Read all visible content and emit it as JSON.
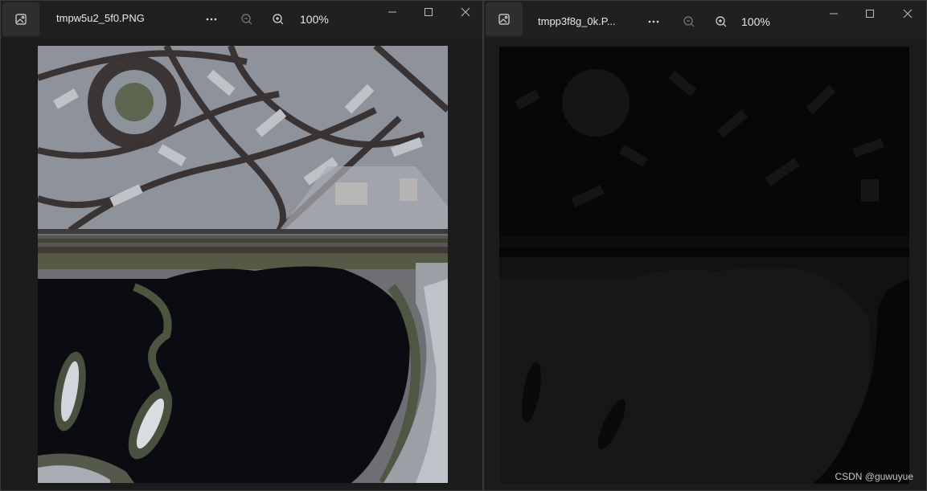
{
  "windows": [
    {
      "title": "tmpw5u2_5f0.PNG",
      "zoom": "100%"
    },
    {
      "title": "tmpp3f8g_0k.P...",
      "zoom": "100%"
    }
  ],
  "watermark": "CSDN @guwuyue",
  "icons": {
    "app": "image-icon",
    "more": "more-icon",
    "zoom_out": "zoom-out-icon",
    "zoom_in": "zoom-in-icon",
    "minimize": "minimize-icon",
    "maximize": "maximize-icon",
    "close": "close-icon"
  },
  "colors": {
    "titlebar": "#202020",
    "window_bg": "#1c1c1c",
    "text": "#e8e8e8"
  }
}
